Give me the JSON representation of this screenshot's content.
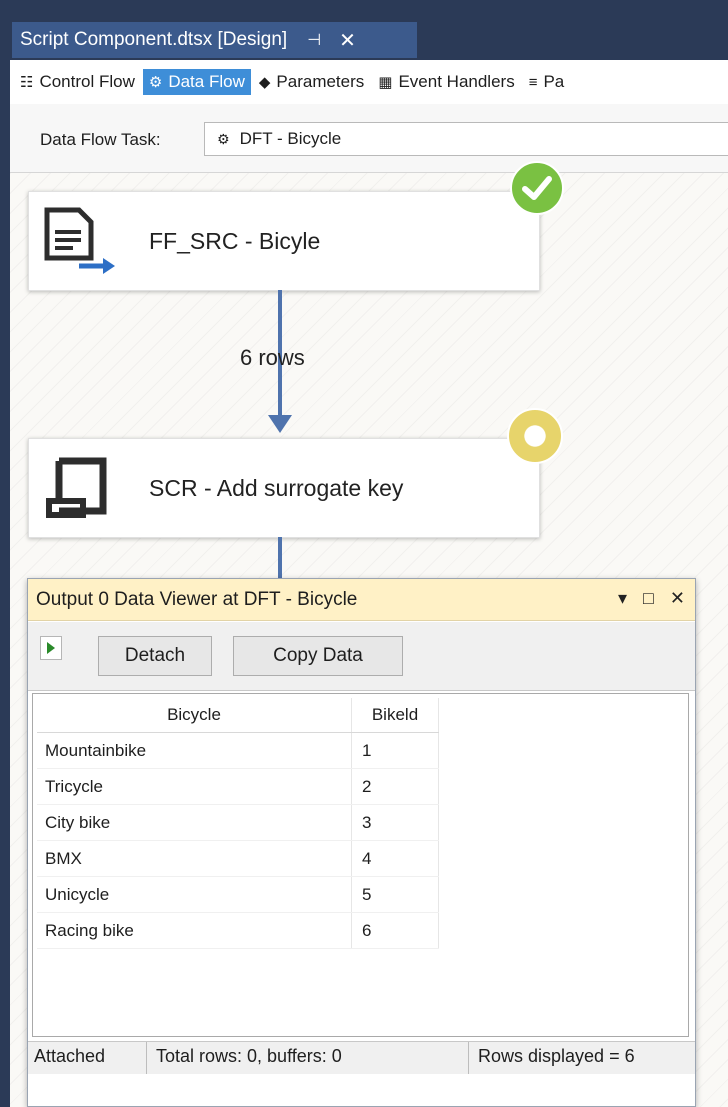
{
  "window": {
    "doc_tab_title": "Script Component.dtsx [Design]",
    "pin_glyph": "⊣",
    "close_glyph": "✕"
  },
  "designer_tabs": [
    {
      "label": "Control Flow",
      "icon": "control-flow-icon"
    },
    {
      "label": "Data Flow",
      "icon": "data-flow-icon",
      "active": true
    },
    {
      "label": "Parameters",
      "icon": "parameters-icon"
    },
    {
      "label": "Event Handlers",
      "icon": "event-handlers-icon"
    },
    {
      "label": "Pa",
      "icon": "package-explorer-icon"
    }
  ],
  "task_bar": {
    "label": "Data Flow Task:",
    "selected": "DFT - Bicycle"
  },
  "components": {
    "source": {
      "label": "FF_SRC - Bicyle",
      "status": "success"
    },
    "script": {
      "label": "SCR - Add surrogate key",
      "status": "running"
    },
    "path_label": "6 rows"
  },
  "viewer": {
    "title": "Output 0 Data Viewer at DFT - Bicycle",
    "detach_label": "Detach",
    "copy_label": "Copy Data",
    "columns": [
      "Bicycle",
      "Bikeld"
    ],
    "rows": [
      [
        "Mountainbike",
        "1"
      ],
      [
        "Tricycle",
        "2"
      ],
      [
        "City bike",
        "3"
      ],
      [
        "BMX",
        "4"
      ],
      [
        "Unicycle",
        "5"
      ],
      [
        "Racing bike",
        "6"
      ]
    ],
    "status_attached": "Attached",
    "status_total": "Total rows: 0, buffers: 0",
    "status_displayed": "Rows displayed = 6"
  },
  "colors": {
    "title_band": "#2b3a57",
    "active_tab": "#3e8ed8",
    "path_line": "#4f73ad",
    "viewer_title_bg": "#fff1c6",
    "success_green": "#7ac142"
  }
}
